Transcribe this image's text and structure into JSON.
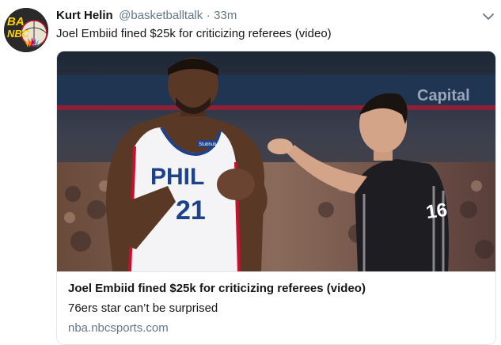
{
  "tweet": {
    "author_name": "Kurt Helin",
    "author_handle": "@basketballtalk",
    "separator": "·",
    "time": "33m",
    "text": "Joel Embiid fined $25k for criticizing referees (video)",
    "avatar_text": [
      "BA",
      "NBC"
    ],
    "menu_icon": "chevron-down-icon"
  },
  "card": {
    "title": "Joel Embiid fined $25k for criticizing referees (video)",
    "description": "76ers star can’t be surprised",
    "domain": "nba.nbcsports.com",
    "photo": {
      "jersey_text": "PHIL",
      "jersey_number": "21",
      "jersey_patch": "Stubhub",
      "referee_number": "16",
      "arena_banner": "Capital"
    }
  },
  "colors": {
    "link_gray": "#657786",
    "text": "#14171a",
    "border": "#e1e8ed",
    "sixers_blue": "#1d428a",
    "sixers_red": "#c8102e"
  }
}
